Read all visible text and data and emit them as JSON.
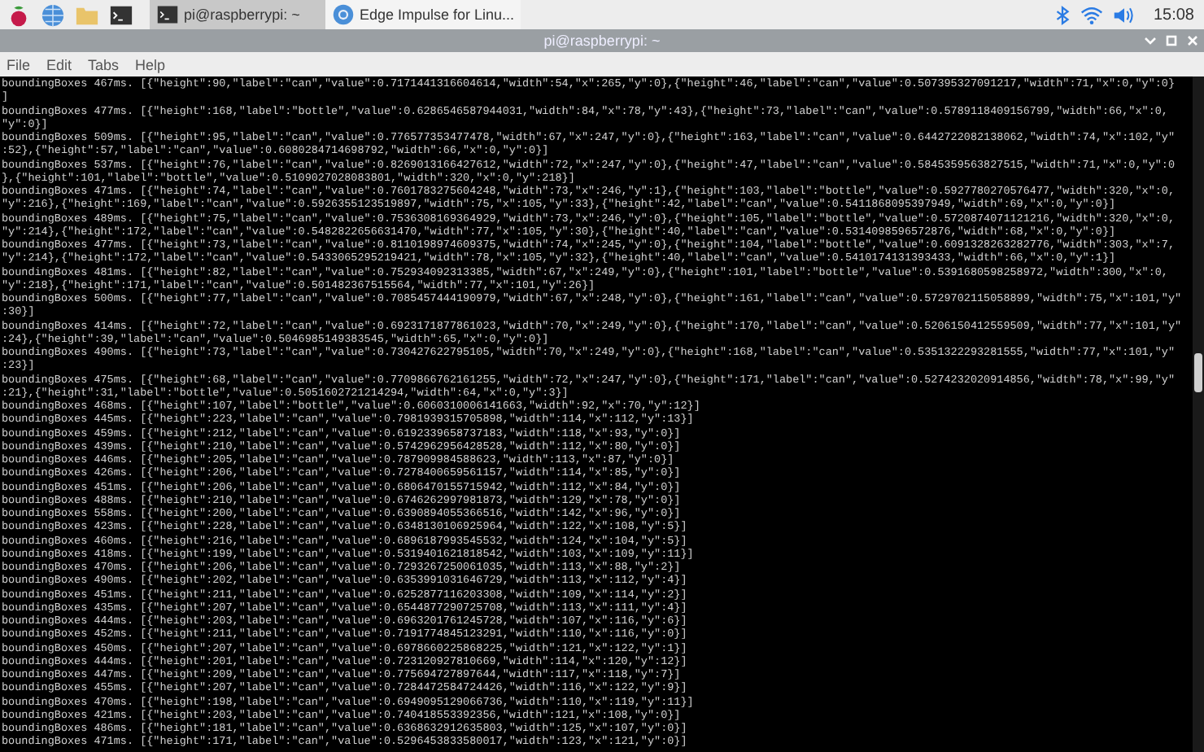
{
  "taskbar": {
    "tasks": [
      {
        "title": "pi@raspberrypi: ~",
        "kind": "terminal",
        "selected": true
      },
      {
        "title": "Edge Impulse for Linu...",
        "kind": "browser",
        "selected": false
      }
    ],
    "clock": "15:08"
  },
  "window": {
    "title": "pi@raspberrypi: ~"
  },
  "menu": [
    "File",
    "Edit",
    "Tabs",
    "Help"
  ],
  "terminal": {
    "lines": [
      "boundingBoxes 467ms. [{\"height\":90,\"label\":\"can\",\"value\":0.7171441316604614,\"width\":54,\"x\":265,\"y\":0},{\"height\":46,\"label\":\"can\",\"value\":0.507395327091217,\"width\":71,\"x\":0,\"y\":0}",
      "]",
      "boundingBoxes 477ms. [{\"height\":168,\"label\":\"bottle\",\"value\":0.6286546587944031,\"width\":84,\"x\":78,\"y\":43},{\"height\":73,\"label\":\"can\",\"value\":0.5789118409156799,\"width\":66,\"x\":0,",
      "\"y\":0}]",
      "boundingBoxes 509ms. [{\"height\":95,\"label\":\"can\",\"value\":0.776577353477478,\"width\":67,\"x\":247,\"y\":0},{\"height\":163,\"label\":\"can\",\"value\":0.6442722082138062,\"width\":74,\"x\":102,\"y\"",
      ":52},{\"height\":57,\"label\":\"can\",\"value\":0.6080284714698792,\"width\":66,\"x\":0,\"y\":0}]",
      "boundingBoxes 537ms. [{\"height\":76,\"label\":\"can\",\"value\":0.8269013166427612,\"width\":72,\"x\":247,\"y\":0},{\"height\":47,\"label\":\"can\",\"value\":0.5845359563827515,\"width\":71,\"x\":0,\"y\":0",
      "},{\"height\":101,\"label\":\"bottle\",\"value\":0.5109027028083801,\"width\":320,\"x\":0,\"y\":218}]",
      "boundingBoxes 471ms. [{\"height\":74,\"label\":\"can\",\"value\":0.7601783275604248,\"width\":73,\"x\":246,\"y\":1},{\"height\":103,\"label\":\"bottle\",\"value\":0.5927780270576477,\"width\":320,\"x\":0,",
      "\"y\":216},{\"height\":169,\"label\":\"can\",\"value\":0.5926355123519897,\"width\":75,\"x\":105,\"y\":33},{\"height\":42,\"label\":\"can\",\"value\":0.5411868095397949,\"width\":69,\"x\":0,\"y\":0}]",
      "boundingBoxes 489ms. [{\"height\":75,\"label\":\"can\",\"value\":0.7536308169364929,\"width\":73,\"x\":246,\"y\":0},{\"height\":105,\"label\":\"bottle\",\"value\":0.5720874071121216,\"width\":320,\"x\":0,",
      "\"y\":214},{\"height\":172,\"label\":\"can\",\"value\":0.5482822656631470,\"width\":77,\"x\":105,\"y\":30},{\"height\":40,\"label\":\"can\",\"value\":0.5314098596572876,\"width\":68,\"x\":0,\"y\":0}]",
      "boundingBoxes 477ms. [{\"height\":73,\"label\":\"can\",\"value\":0.8110198974609375,\"width\":74,\"x\":245,\"y\":0},{\"height\":104,\"label\":\"bottle\",\"value\":0.6091328263282776,\"width\":303,\"x\":7,",
      "\"y\":214},{\"height\":172,\"label\":\"can\",\"value\":0.5433065295219421,\"width\":78,\"x\":105,\"y\":32},{\"height\":40,\"label\":\"can\",\"value\":0.5410174131393433,\"width\":66,\"x\":0,\"y\":1}]",
      "boundingBoxes 481ms. [{\"height\":82,\"label\":\"can\",\"value\":0.752934092313385,\"width\":67,\"x\":249,\"y\":0},{\"height\":101,\"label\":\"bottle\",\"value\":0.5391680598258972,\"width\":300,\"x\":0,",
      "\"y\":218},{\"height\":171,\"label\":\"can\",\"value\":0.501482367515564,\"width\":77,\"x\":101,\"y\":26}]",
      "boundingBoxes 500ms. [{\"height\":77,\"label\":\"can\",\"value\":0.7085457444190979,\"width\":67,\"x\":248,\"y\":0},{\"height\":161,\"label\":\"can\",\"value\":0.5729702115058899,\"width\":75,\"x\":101,\"y\"",
      ":30}]",
      "boundingBoxes 414ms. [{\"height\":72,\"label\":\"can\",\"value\":0.6923171877861023,\"width\":70,\"x\":249,\"y\":0},{\"height\":170,\"label\":\"can\",\"value\":0.5206150412559509,\"width\":77,\"x\":101,\"y\"",
      ":24},{\"height\":39,\"label\":\"can\",\"value\":0.5046985149383545,\"width\":65,\"x\":0,\"y\":0}]",
      "boundingBoxes 490ms. [{\"height\":73,\"label\":\"can\",\"value\":0.730427622795105,\"width\":70,\"x\":249,\"y\":0},{\"height\":168,\"label\":\"can\",\"value\":0.5351322293281555,\"width\":77,\"x\":101,\"y\"",
      ":23}]",
      "boundingBoxes 475ms. [{\"height\":68,\"label\":\"can\",\"value\":0.7709866762161255,\"width\":72,\"x\":247,\"y\":0},{\"height\":171,\"label\":\"can\",\"value\":0.5274232020914856,\"width\":78,\"x\":99,\"y\"",
      ":21},{\"height\":31,\"label\":\"bottle\",\"value\":0.5051602721214294,\"width\":64,\"x\":0,\"y\":3}]",
      "boundingBoxes 468ms. [{\"height\":107,\"label\":\"bottle\",\"value\":0.6060310006141663,\"width\":92,\"x\":70,\"y\":12}]",
      "boundingBoxes 445ms. [{\"height\":223,\"label\":\"can\",\"value\":0.7981939315705898,\"width\":114,\"x\":112,\"y\":13}]",
      "boundingBoxes 459ms. [{\"height\":212,\"label\":\"can\",\"value\":0.6192339658737183,\"width\":118,\"x\":93,\"y\":0}]",
      "boundingBoxes 439ms. [{\"height\":210,\"label\":\"can\",\"value\":0.5742962956428528,\"width\":112,\"x\":80,\"y\":0}]",
      "boundingBoxes 446ms. [{\"height\":205,\"label\":\"can\",\"value\":0.787909984588623,\"width\":113,\"x\":87,\"y\":0}]",
      "boundingBoxes 426ms. [{\"height\":206,\"label\":\"can\",\"value\":0.7278400659561157,\"width\":114,\"x\":85,\"y\":0}]",
      "boundingBoxes 451ms. [{\"height\":206,\"label\":\"can\",\"value\":0.6806470155715942,\"width\":112,\"x\":84,\"y\":0}]",
      "boundingBoxes 488ms. [{\"height\":210,\"label\":\"can\",\"value\":0.6746262997981873,\"width\":129,\"x\":78,\"y\":0}]",
      "boundingBoxes 558ms. [{\"height\":200,\"label\":\"can\",\"value\":0.6390894055366516,\"width\":142,\"x\":96,\"y\":0}]",
      "boundingBoxes 423ms. [{\"height\":228,\"label\":\"can\",\"value\":0.6348130106925964,\"width\":122,\"x\":108,\"y\":5}]",
      "boundingBoxes 460ms. [{\"height\":216,\"label\":\"can\",\"value\":0.6896187993545532,\"width\":124,\"x\":104,\"y\":5}]",
      "boundingBoxes 418ms. [{\"height\":199,\"label\":\"can\",\"value\":0.5319401621818542,\"width\":103,\"x\":109,\"y\":11}]",
      "boundingBoxes 470ms. [{\"height\":206,\"label\":\"can\",\"value\":0.7293267250061035,\"width\":113,\"x\":88,\"y\":2}]",
      "boundingBoxes 490ms. [{\"height\":202,\"label\":\"can\",\"value\":0.6353991031646729,\"width\":113,\"x\":112,\"y\":4}]",
      "boundingBoxes 451ms. [{\"height\":211,\"label\":\"can\",\"value\":0.6252877116203308,\"width\":109,\"x\":114,\"y\":2}]",
      "boundingBoxes 435ms. [{\"height\":207,\"label\":\"can\",\"value\":0.6544877290725708,\"width\":113,\"x\":111,\"y\":4}]",
      "boundingBoxes 444ms. [{\"height\":203,\"label\":\"can\",\"value\":0.6963201761245728,\"width\":107,\"x\":116,\"y\":6}]",
      "boundingBoxes 452ms. [{\"height\":211,\"label\":\"can\",\"value\":0.7191774845123291,\"width\":110,\"x\":116,\"y\":0}]",
      "boundingBoxes 450ms. [{\"height\":207,\"label\":\"can\",\"value\":0.6978660225868225,\"width\":121,\"x\":122,\"y\":1}]",
      "boundingBoxes 444ms. [{\"height\":201,\"label\":\"can\",\"value\":0.723120927810669,\"width\":114,\"x\":120,\"y\":12}]",
      "boundingBoxes 447ms. [{\"height\":209,\"label\":\"can\",\"value\":0.775694727897644,\"width\":117,\"x\":118,\"y\":7}]",
      "boundingBoxes 455ms. [{\"height\":207,\"label\":\"can\",\"value\":0.7284472584724426,\"width\":116,\"x\":122,\"y\":9}]",
      "boundingBoxes 470ms. [{\"height\":198,\"label\":\"can\",\"value\":0.6949095129066736,\"width\":110,\"x\":119,\"y\":11}]",
      "boundingBoxes 421ms. [{\"height\":203,\"label\":\"can\",\"value\":0.740418553392356,\"width\":121,\"x\":108,\"y\":0}]",
      "boundingBoxes 486ms. [{\"height\":181,\"label\":\"can\",\"value\":0.6368632912635803,\"width\":125,\"x\":107,\"y\":0}]",
      "boundingBoxes 471ms. [{\"height\":171,\"label\":\"can\",\"value\":0.5296453833580017,\"width\":123,\"x\":121,\"y\":0}]"
    ]
  }
}
